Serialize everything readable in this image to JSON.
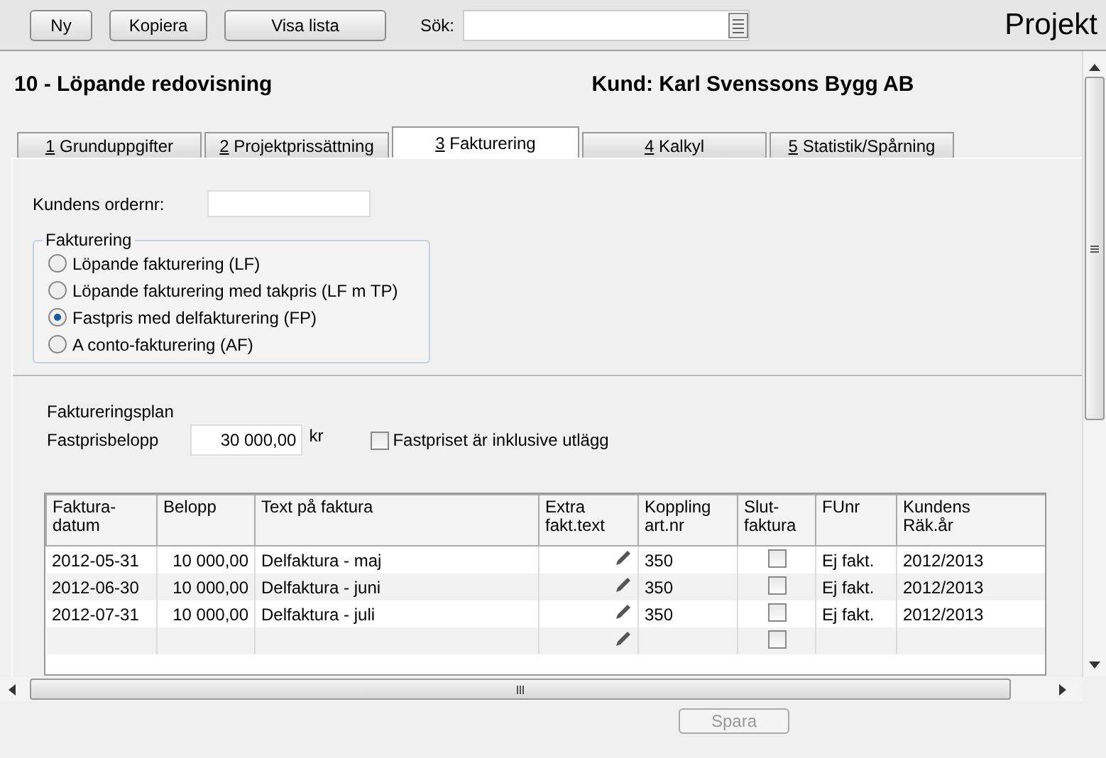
{
  "toolbar": {
    "buttons": [
      "Ny",
      "Kopiera",
      "Visa lista"
    ],
    "search_label": "Sök:",
    "title": "Projekt"
  },
  "header": {
    "project": "10 - Löpande redovisning",
    "customer": "Kund: Karl Svenssons Bygg AB"
  },
  "tabs": [
    {
      "key": "1",
      "label": "Grunduppgifter",
      "selected": false
    },
    {
      "key": "2",
      "label": "Projektprissättning",
      "selected": false
    },
    {
      "key": "3",
      "label": "Fakturering",
      "selected": true
    },
    {
      "key": "4",
      "label": "Kalkyl",
      "selected": false
    },
    {
      "key": "5",
      "label": "Statistik/Spårning",
      "selected": false
    }
  ],
  "order_label": "Kundens ordernr:",
  "billing_group": {
    "title": "Fakturering",
    "options": [
      {
        "label": "Löpande fakturering (LF)",
        "selected": false
      },
      {
        "label": "Löpande fakturering med takpris (LF m TP)",
        "selected": false
      },
      {
        "label": "Fastpris med delfakturering (FP)",
        "selected": true
      },
      {
        "label": "A conto-fakturering (AF)",
        "selected": false
      }
    ]
  },
  "plan": {
    "title": "Faktureringsplan",
    "amount_label": "Fastprisbelopp",
    "amount": "30 000,00",
    "unit": "kr",
    "inclusive": {
      "label": "Fastpriset är inklusive utlägg",
      "checked": false
    }
  },
  "table": {
    "columns": [
      "Faktura-\ndatum",
      "Belopp",
      "Text på faktura",
      "Extra\nfakt.text",
      "Koppling\nart.nr",
      "Slut-\nfaktura",
      "FUnr",
      "Kundens\nRäk.år"
    ],
    "rows": [
      {
        "datum": "2012-05-31",
        "belopp": "10 000,00",
        "text": "Delfaktura - maj",
        "koppling": "350",
        "slutfaktura": false,
        "funr": "Ej fakt.",
        "ar": "2012/2013"
      },
      {
        "datum": "2012-06-30",
        "belopp": "10 000,00",
        "text": "Delfaktura - juni",
        "koppling": "350",
        "slutfaktura": false,
        "funr": "Ej fakt.",
        "ar": "2012/2013"
      },
      {
        "datum": "2012-07-31",
        "belopp": "10 000,00",
        "text": "Delfaktura - juli",
        "koppling": "350",
        "slutfaktura": false,
        "funr": "Ej fakt.",
        "ar": "2012/2013"
      },
      {
        "slutfaktura": false
      }
    ]
  },
  "save_button": {
    "label": "Spara",
    "disabled": true
  }
}
